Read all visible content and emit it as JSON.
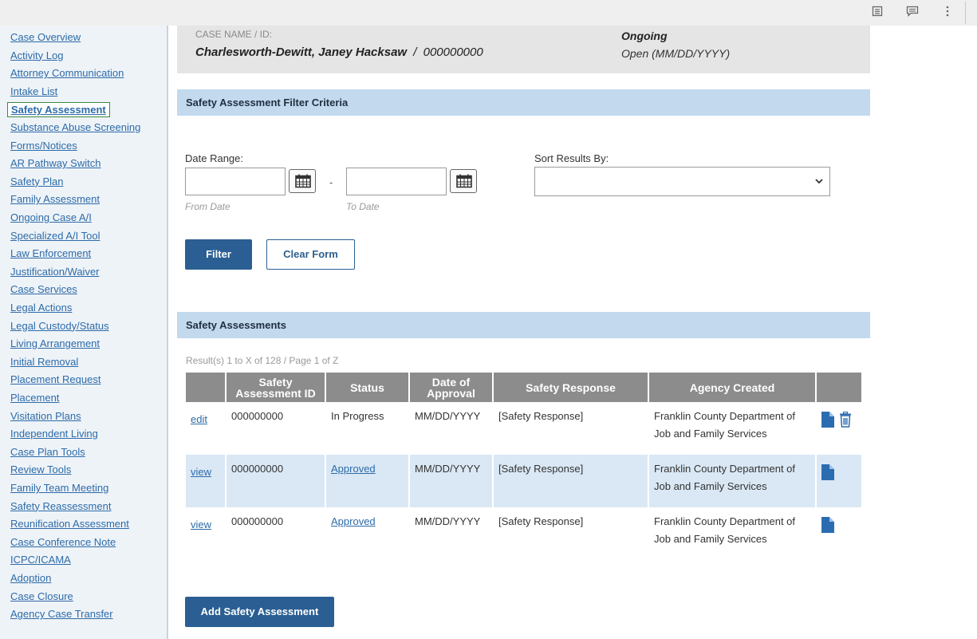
{
  "topbar": {
    "icons": [
      "document-icon",
      "comment-icon",
      "more-vert-icon"
    ]
  },
  "sidebar": {
    "items": [
      "Case Overview",
      "Activity Log",
      "Attorney Communication",
      "Intake List",
      "Safety Assessment",
      "Substance Abuse Screening",
      "Forms/Notices",
      "AR Pathway Switch",
      "Safety Plan",
      "Family Assessment",
      "Ongoing Case A/I",
      "Specialized A/I Tool",
      "Law Enforcement",
      "Justification/Waiver",
      "Case Services",
      "Legal Actions",
      "Legal Custody/Status",
      "Living Arrangement",
      "Initial Removal",
      "Placement Request",
      "Placement",
      "Visitation Plans",
      "Independent Living",
      "Case Plan Tools",
      "Review Tools",
      "Family Team Meeting",
      "Safety Reassessment",
      "Reunification Assessment",
      "Case Conference Note",
      "ICPC/ICAMA",
      "Adoption",
      "Case Closure",
      "Agency Case Transfer"
    ],
    "active_index": 4
  },
  "case_header": {
    "label": "CASE NAME / ID:",
    "name": "Charlesworth-Dewitt, Janey Hacksaw",
    "separator": "/",
    "id": "000000000",
    "status": "Ongoing",
    "status_detail": "Open (MM/DD/YYYY)"
  },
  "filter": {
    "section_title": "Safety Assessment Filter Criteria",
    "date_range_label": "Date Range:",
    "dash": "-",
    "from_sublabel": "From Date",
    "to_sublabel": "To Date",
    "sort_label": "Sort Results By:",
    "sort_value": "",
    "filter_button": "Filter",
    "clear_button": "Clear Form"
  },
  "assessments": {
    "section_title": "Safety Assessments",
    "results_text": "Result(s) 1 to X of 128 / Page 1 of Z",
    "columns": [
      "",
      "Safety Assessment ID",
      "Status",
      "Date of Approval",
      "Safety Response",
      "Agency Created",
      ""
    ],
    "rows": [
      {
        "action": "edit",
        "id": "000000000",
        "status": "In Progress",
        "status_link": false,
        "date": "MM/DD/YYYY",
        "response": "[Safety Response]",
        "agency_line1": "Franklin County Department of",
        "agency_line2": "Job and Family Services",
        "icons": [
          "document-icon",
          "trash-icon"
        ]
      },
      {
        "action": "view",
        "id": "000000000",
        "status": "Approved",
        "status_link": true,
        "date": "MM/DD/YYYY",
        "response": "[Safety Response]",
        "agency_line1": "Franklin County Department of",
        "agency_line2": "Job and Family Services",
        "icons": [
          "document-icon"
        ]
      },
      {
        "action": "view",
        "id": "000000000",
        "status": "Approved",
        "status_link": true,
        "date": "MM/DD/YYYY",
        "response": "[Safety Response]",
        "agency_line1": "Franklin County Department of",
        "agency_line2": "Job and Family Services",
        "icons": [
          "document-icon"
        ]
      }
    ],
    "add_button": "Add Safety Assessment"
  },
  "colors": {
    "primary": "#2b5f93",
    "section_bar": "#c2d9ee",
    "link": "#2d6ba8",
    "row_highlight": "#dae8f5",
    "table_header": "#8c8c8c"
  }
}
